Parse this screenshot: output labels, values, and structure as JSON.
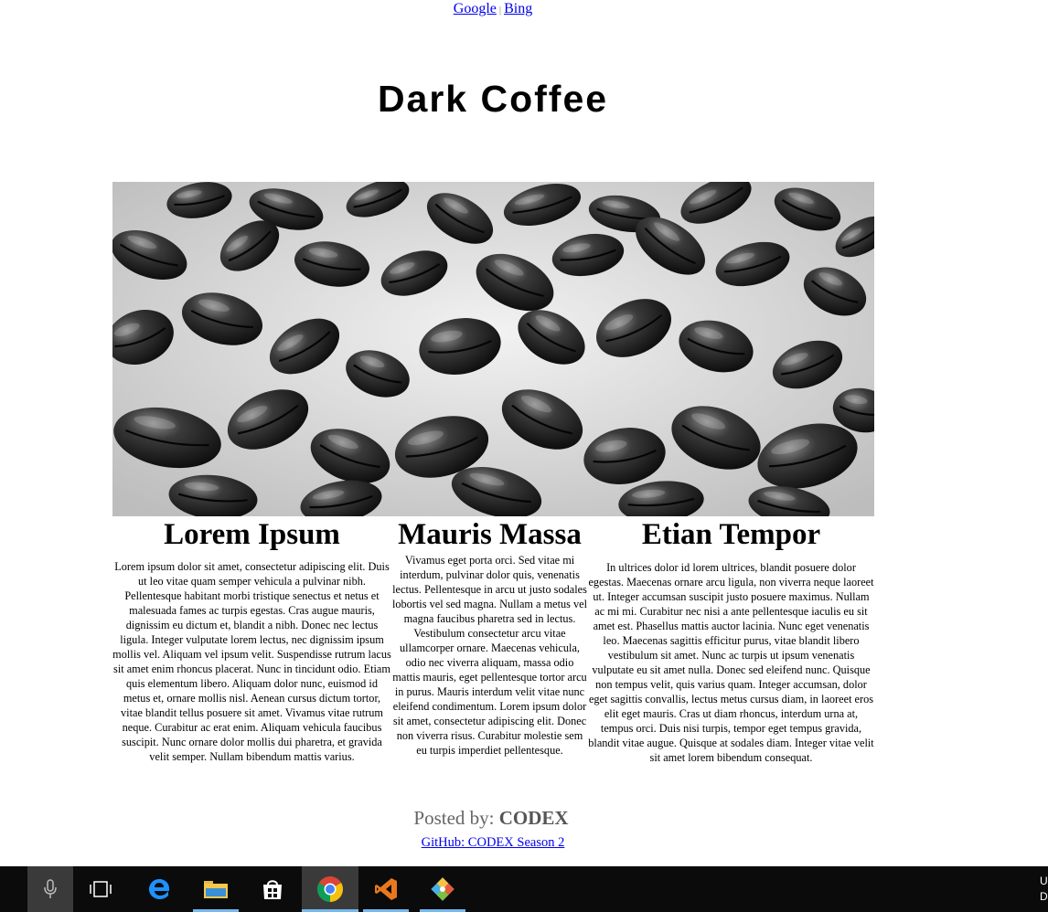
{
  "nav": {
    "links": [
      "Google",
      "Bing"
    ],
    "separator": "|"
  },
  "page": {
    "title": "Dark Coffee"
  },
  "columns": [
    {
      "heading": "Lorem Ipsum",
      "text": "Lorem ipsum dolor sit amet, consectetur adipiscing elit. Duis ut leo vitae quam semper vehicula a pulvinar nibh. Pellentesque habitant morbi tristique senectus et netus et malesuada fames ac turpis egestas. Cras augue mauris, dignissim eu dictum et, blandit a nibh. Donec nec lectus ligula. Integer vulputate lorem lectus, nec dignissim ipsum mollis vel. Aliquam vel ipsum velit. Suspendisse rutrum lacus sit amet enim rhoncus placerat. Nunc in tincidunt odio. Etiam quis elementum libero. Aliquam dolor nunc, euismod id metus et, ornare mollis nisl. Aenean cursus dictum tortor, vitae blandit tellus posuere sit amet. Vivamus vitae rutrum neque. Curabitur ac erat enim. Aliquam vehicula faucibus suscipit. Nunc ornare dolor mollis dui pharetra, et gravida velit semper. Nullam bibendum mattis varius."
    },
    {
      "heading": "Mauris Massa",
      "text": "Vivamus eget porta orci. Sed vitae mi interdum, pulvinar dolor quis, venenatis lectus. Pellentesque in arcu ut justo sodales lobortis vel sed magna. Nullam a metus vel magna faucibus pharetra sed in lectus. Vestibulum consectetur arcu vitae ullamcorper ornare. Maecenas vehicula, odio nec viverra aliquam, massa odio mattis mauris, eget pellentesque tortor arcu in purus. Mauris interdum velit vitae nunc eleifend condimentum. Lorem ipsum dolor sit amet, consectetur adipiscing elit. Donec non viverra risus. Curabitur molestie sem eu turpis imperdiet pellentesque."
    },
    {
      "heading": "Etian Tempor",
      "text": "In ultrices dolor id lorem ultrices, blandit posuere dolor egestas. Maecenas ornare arcu ligula, non viverra neque laoreet ut. Integer accumsan suscipit justo posuere maximus. Nullam ac mi mi. Curabitur nec nisi a ante pellentesque iaculis eu sit amet est. Phasellus mattis auctor lacinia. Nunc eget venenatis leo. Maecenas sagittis efficitur purus, vitae blandit libero vestibulum sit amet. Nunc ac turpis ut ipsum venenatis vulputate eu sit amet nulla. Donec sed eleifend nunc. Quisque non tempus velit, quis varius quam. Integer accumsan, dolor eget sagittis convallis, lectus metus cursus diam, in laoreet eros elit eget mauris. Cras ut diam rhoncus, interdum urna at, tempus orci. Duis nisi turpis, tempor eget tempus gravida, blandit vitae augue. Quisque at sodales diam. Integer vitae velit sit amet lorem bibendum consequat."
    }
  ],
  "footer": {
    "posted_prefix": "Posted by:",
    "author": "CODEX",
    "github_link": "GitHub: CODEX Season 2"
  },
  "taskbar": {
    "icons": [
      "microphone-icon",
      "task-view-icon",
      "edge-icon",
      "file-explorer-icon",
      "store-icon",
      "chrome-icon",
      "visual-studio-icon",
      "git-icon"
    ],
    "clock_line1": "U",
    "clock_line2": "D"
  },
  "colors": {
    "link": "#0000ee",
    "taskbar": "#0b0b0b",
    "taskbar_accent": "#76b9ed"
  }
}
